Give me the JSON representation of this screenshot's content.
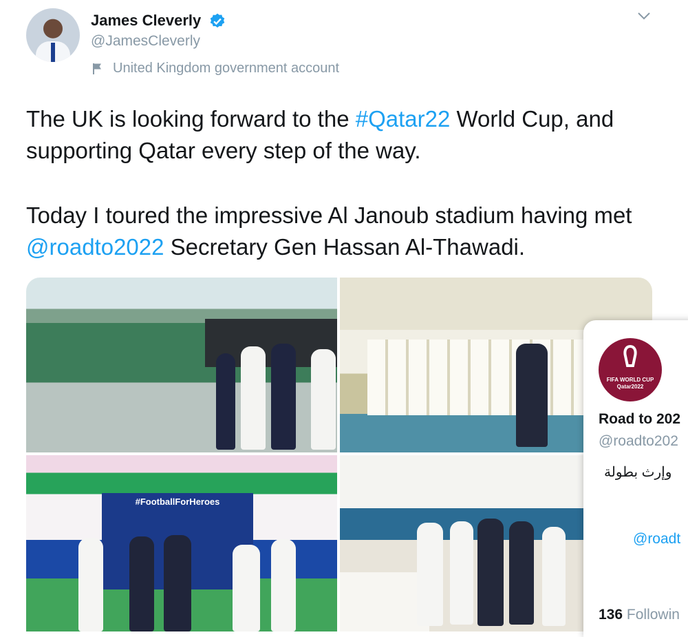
{
  "tweet": {
    "author_name": "James Cleverly",
    "author_handle": "@JamesCleverly",
    "account_label": "United Kingdom government account",
    "text": {
      "line1_pre": "The UK is looking forward to the ",
      "line1_hashtag": "#Qatar22",
      "line1_post": " World Cup, and supporting Qatar every step of the way.",
      "line2_pre": "Today I toured the impressive Al Janoub stadium having met ",
      "line2_mention": "@roadto2022",
      "line2_post": " Secretary Gen Hassan Al-Thawadi."
    },
    "photo_banner": "#FootballForHeroes"
  },
  "hover_card": {
    "logo_line1": "FIFA WORLD CUP",
    "logo_line2": "Qatar2022",
    "name": "Road to 202",
    "handle": "@roadto202",
    "bio": "وإرث بطولة",
    "link": "@roadt",
    "following_count": "136",
    "following_label": "Followin"
  },
  "colors": {
    "link": "#1da1f2",
    "secondary_text": "#8899a6",
    "verified": "#1da1f2",
    "qatar_maroon": "#8a1538"
  },
  "icons": [
    "verified-badge-icon",
    "flag-icon",
    "chevron-down-icon"
  ]
}
